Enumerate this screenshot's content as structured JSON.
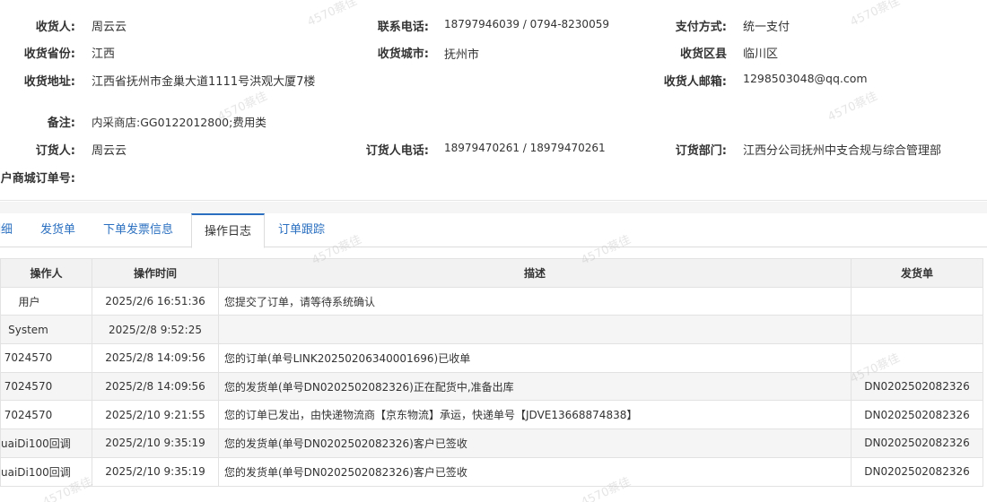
{
  "info": {
    "consignee_label": "收货人:",
    "consignee": "周云云",
    "phone_label": "联系电话:",
    "phone": "18797946039 / 0794-8230059",
    "payment_label": "支付方式:",
    "payment": "统一支付",
    "province_label": "收货省份:",
    "province": "江西",
    "city_label": "收货城市:",
    "city": "抚州市",
    "district_label": "收货区县",
    "district": "临川区",
    "address_label": "收货地址:",
    "address": "江西省抚州市金巢大道1111号洪观大厦7楼",
    "email_label": "收货人邮箱:",
    "email": "1298503048@qq.com",
    "remark_label": "备注:",
    "remark": "内采商店:GG0122012800;费用类",
    "orderer_label": "订货人:",
    "orderer": "周云云",
    "orderer_phone_label": "订货人电话:",
    "orderer_phone": "18979470261 / 18979470261",
    "dept_label": "订货部门:",
    "dept": "江西分公司抚州中支合规与综合管理部",
    "mall_order_label": "户商城订单号:"
  },
  "tabs": [
    "明细",
    "发货单",
    "下单发票信息",
    "操作日志",
    "订单跟踪"
  ],
  "active_tab": "操作日志",
  "log_table": {
    "headers": [
      "操作人",
      "操作时间",
      "描述",
      "发货单"
    ],
    "rows": [
      [
        "用户",
        "2025/2/6 16:51:36",
        "您提交了订单，请等待系统确认",
        ""
      ],
      [
        "System",
        "2025/2/8 9:52:25",
        "",
        ""
      ],
      [
        "7024570",
        "2025/2/8 14:09:56",
        "您的订单(单号LINK20250206340001696)已收单",
        ""
      ],
      [
        "7024570",
        "2025/2/8 14:09:56",
        "您的发货单(单号DN0202502082326)正在配货中,准备出库",
        "DN0202502082326"
      ],
      [
        "7024570",
        "2025/2/10 9:21:55",
        "您的订单已发出，由快递物流商【京东物流】承运，快递单号【JDVE13668874838】",
        "DN0202502082326"
      ],
      [
        "uaiDi100回调",
        "2025/2/10 9:35:19",
        "您的发货单(单号DN0202502082326)客户已签收",
        "DN0202502082326"
      ],
      [
        "uaiDi100回调",
        "2025/2/10 9:35:19",
        "您的发货单(单号DN0202502082326)客户已签收",
        "DN0202502082326"
      ]
    ]
  },
  "watermark": "4570蔡佳"
}
